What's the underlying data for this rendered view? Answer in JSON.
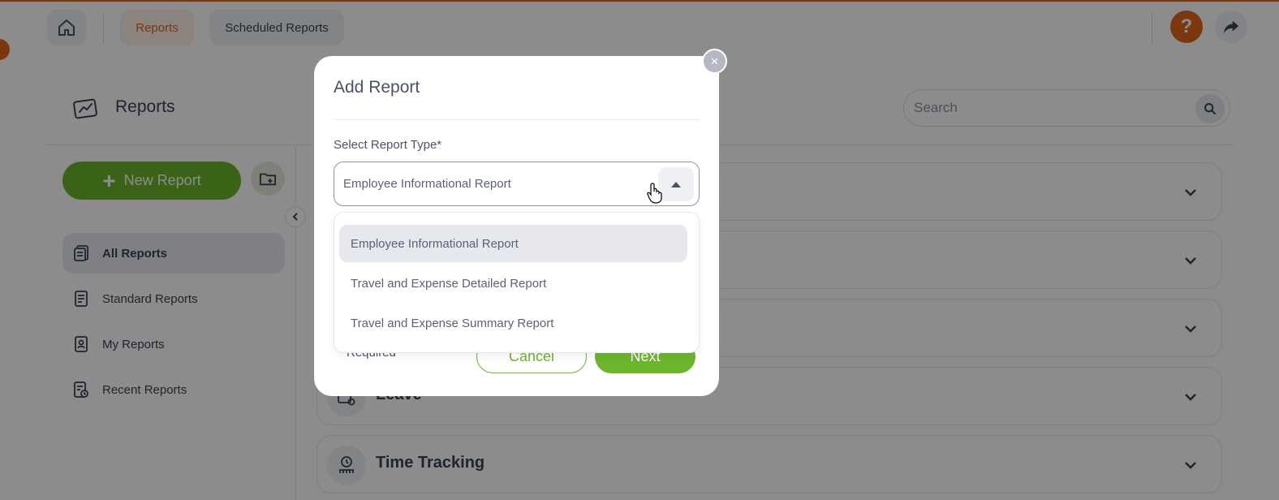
{
  "topbar": {
    "tabs": [
      {
        "label": "Reports",
        "active": true
      },
      {
        "label": "Scheduled Reports",
        "active": false
      }
    ],
    "help_label": "?"
  },
  "page": {
    "title": "Reports",
    "search": {
      "placeholder": "Search"
    },
    "new_report_label": "New Report",
    "sidebar": {
      "items": [
        {
          "label": "All Reports",
          "active": true
        },
        {
          "label": "Standard Reports",
          "active": false
        },
        {
          "label": "My Reports",
          "active": false
        },
        {
          "label": "Recent Reports",
          "active": false
        }
      ]
    },
    "categories": [
      {
        "title": ""
      },
      {
        "title": ""
      },
      {
        "title": ""
      },
      {
        "title": "Leave"
      },
      {
        "title": "Time Tracking"
      }
    ]
  },
  "modal": {
    "title": "Add Report",
    "close_label": "×",
    "field_label": "Select Report Type*",
    "selected_value": "Employee Informational Report",
    "options": [
      "Employee Informational Report",
      "Travel and Expense Detailed Report",
      "Travel and Expense Summary Report"
    ],
    "required_note": "Required",
    "cancel_label": "Cancel",
    "next_label": "Next"
  },
  "colors": {
    "accent_orange": "#e0651a",
    "accent_green": "#6cb52d",
    "text_dark": "#3a4256"
  }
}
